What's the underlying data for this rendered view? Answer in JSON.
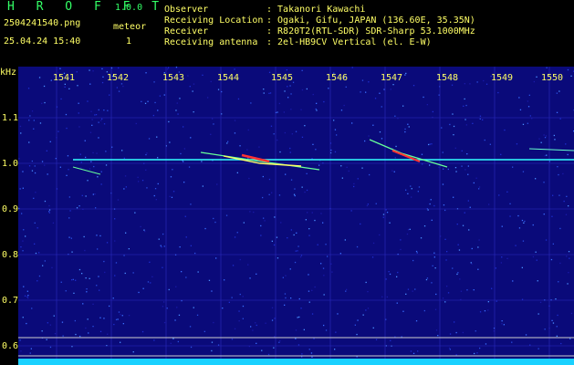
{
  "header": {
    "brand": "H R O F F T",
    "version": "1.0.0",
    "filename": "2504241540.png",
    "datetime": "25.04.24 15:40",
    "meteor_label": "meteor",
    "meteor_count": "1",
    "fields": [
      {
        "label": "Observer",
        "value": ": Takanori Kawachi"
      },
      {
        "label": "Receiving Location",
        "value": ": Ogaki, Gifu, JAPAN (136.60E, 35.35N)"
      },
      {
        "label": "Receiver",
        "value": ": R820T2(RTL-SDR) SDR-Sharp 53.1000MHz"
      },
      {
        "label": "Receiving antenna",
        "value": ": 2el-HB9CV Vertical (el. E-W)"
      }
    ]
  },
  "spectrogram": {
    "y_unit": "kHz",
    "y_ticks": [
      "1.1",
      "1.0",
      "0.9",
      "0.8",
      "0.7",
      "0.6"
    ],
    "x_ticks": [
      "1541",
      "1542",
      "1543",
      "1544",
      "1545",
      "1546",
      "1547",
      "1548",
      "1549",
      "1550"
    ],
    "background_color": "#0a0a7a",
    "carrier_color": "#33ffff",
    "meteor_color": "#ff3333"
  },
  "chart_data": {
    "type": "heatmap",
    "x_ticks": [
      1541,
      1542,
      1543,
      1544,
      1545,
      1546,
      1547,
      1548,
      1549,
      1550
    ],
    "y_ticks": [
      1.1,
      1.0,
      0.9,
      0.8,
      0.7,
      0.6
    ],
    "ylabel": "kHz",
    "carrier_khz": 1.01,
    "meteor_echoes": [
      {
        "x_start": 1543.5,
        "x_end": 1546.1,
        "khz_center": 1.0
      },
      {
        "x_start": 1546.0,
        "x_end": 1548.5,
        "khz_center": 1.01
      }
    ]
  }
}
